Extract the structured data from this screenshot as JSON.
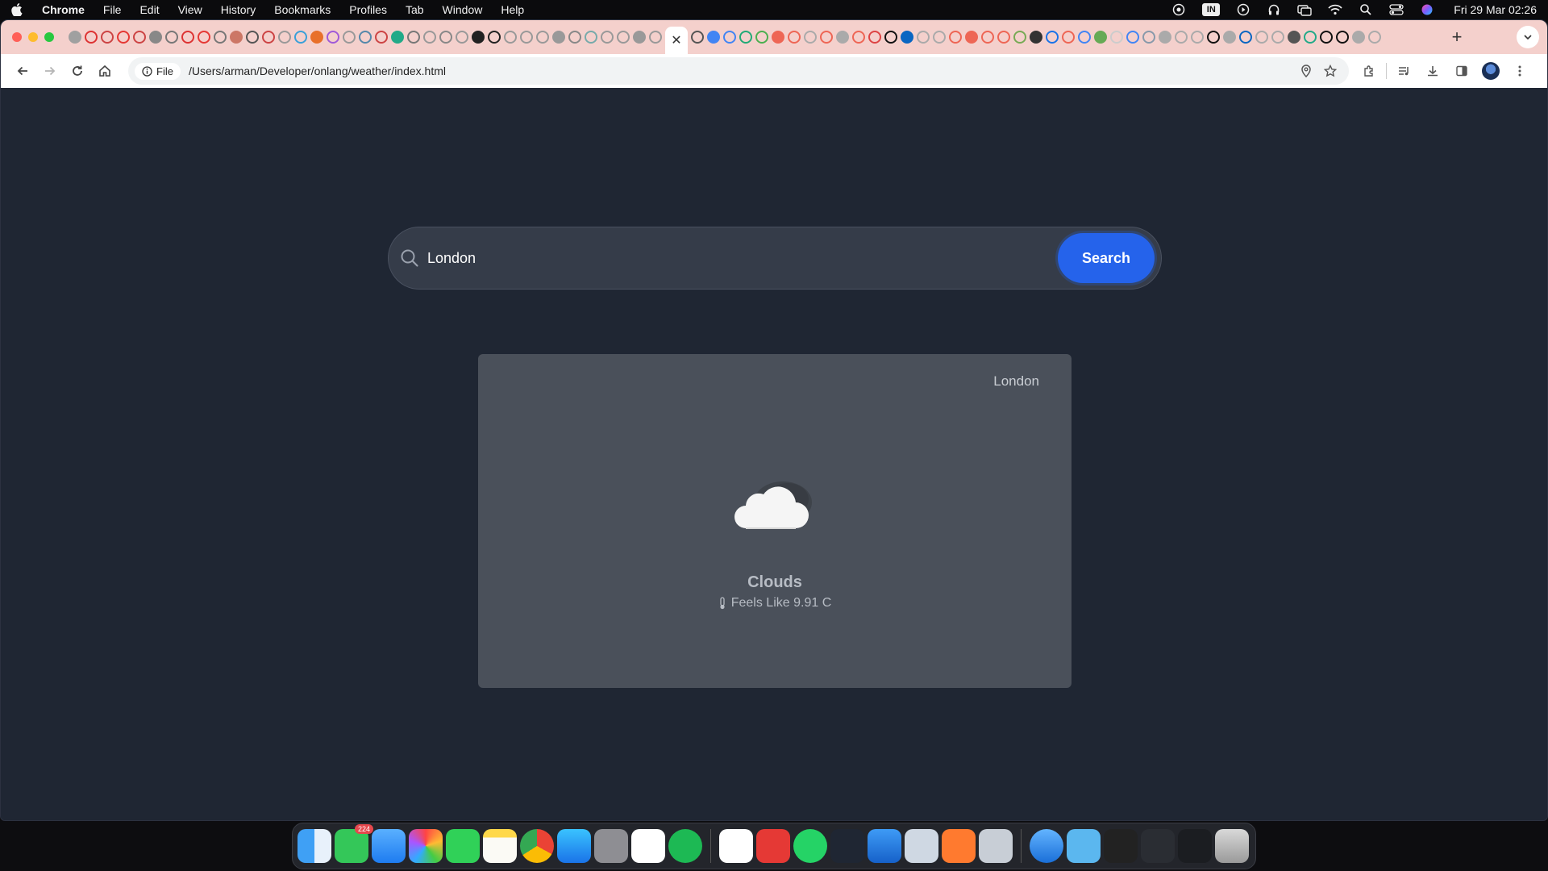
{
  "menubar": {
    "app_name": "Chrome",
    "items": [
      "File",
      "Edit",
      "View",
      "History",
      "Bookmarks",
      "Profiles",
      "Tab",
      "Window",
      "Help"
    ],
    "keyboard_label": "IN",
    "clock": "Fri 29 Mar  02:26"
  },
  "browser": {
    "new_tab_label": "+",
    "close_tab_label": "✕",
    "address": {
      "chip_label": "File",
      "url": "/Users/arman/Developer/onlang/weather/index.html"
    }
  },
  "weather_app": {
    "search": {
      "value": "London",
      "button_label": "Search"
    },
    "card": {
      "city": "London",
      "description": "Clouds",
      "feels_like": "Feels Like 9.91 C",
      "icon": "cloud-icon"
    }
  },
  "dock": {
    "messages_badge": "224"
  },
  "colors": {
    "page_bg": "#1f2633",
    "card_bg": "#4a505a",
    "accent": "#2563eb",
    "tabstrip": "#f4d0cc"
  }
}
